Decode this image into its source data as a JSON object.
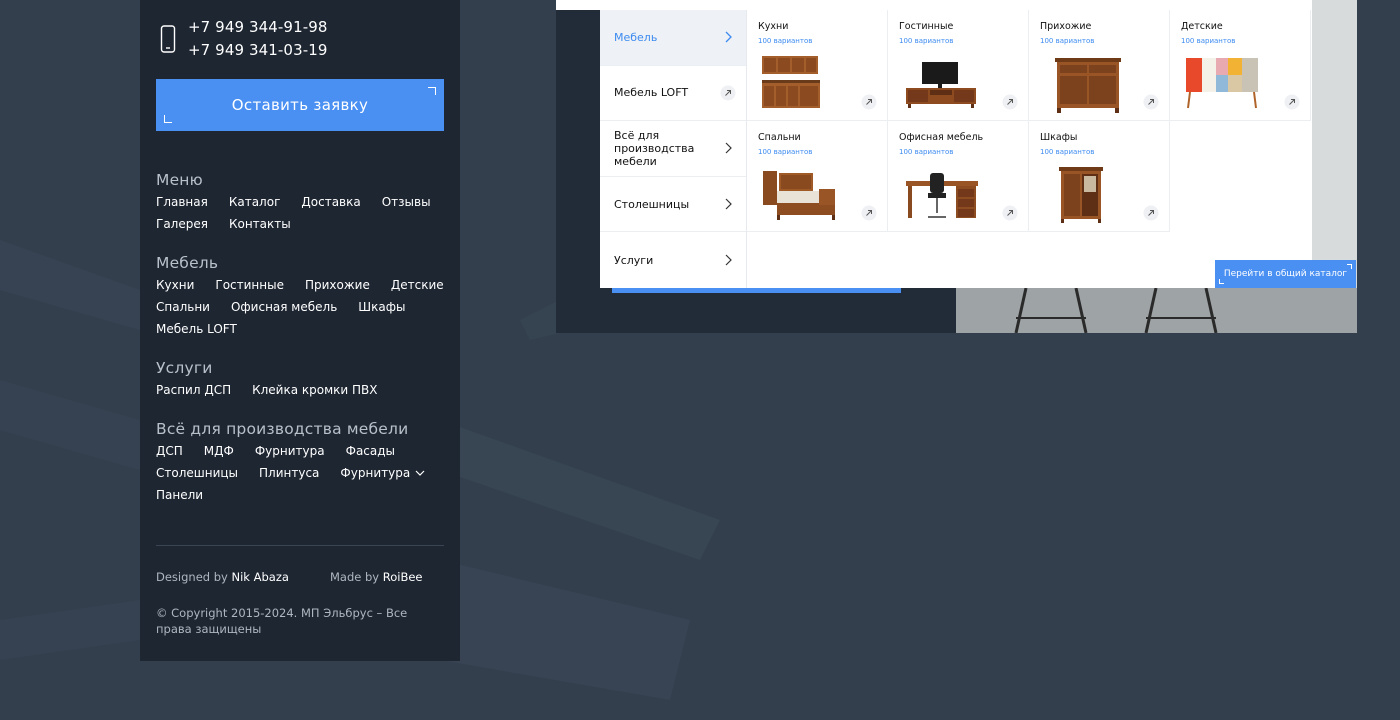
{
  "footer": {
    "phones": [
      "+7 949 344-91-98",
      "+7 949 341-03-19"
    ],
    "cta_label": "Оставить заявку",
    "sections": [
      {
        "heading": "Меню",
        "links": [
          "Главная",
          "Каталог",
          "Доставка",
          "Отзывы",
          "Галерея",
          "Контакты"
        ]
      },
      {
        "heading": "Мебель",
        "links": [
          "Кухни",
          "Гостинные",
          "Прихожие",
          "Детские",
          "Спальни",
          "Офисная мебель",
          "Шкафы",
          "Мебель LOFT"
        ]
      },
      {
        "heading": "Услуги",
        "links": [
          "Распил ДСП",
          "Клейка кромки ПВХ"
        ]
      },
      {
        "heading": "Всё для производства мебели",
        "links": [
          "ДСП",
          "МДФ",
          "Фурнитура",
          "Фасады",
          "Столешницы",
          "Плинтуса",
          "Фурнитура",
          "Панели"
        ]
      }
    ],
    "designed_prefix": "Designed by",
    "designed_name": "Nik Abaza",
    "made_prefix": "Made by",
    "made_name": "RoiBee",
    "copyright": "© Copyright 2015-2024. МП Эльбрус – Все права защищены"
  },
  "catalog": {
    "menu": [
      {
        "label": "Мебель",
        "active": true,
        "icon": "chevron-right-icon"
      },
      {
        "label": "Мебель LOFT",
        "active": false,
        "icon": "arrow-up-right-icon"
      },
      {
        "label": "Всё для производства мебели",
        "active": false,
        "icon": "chevron-right-icon"
      },
      {
        "label": "Столешницы",
        "active": false,
        "icon": "chevron-right-icon"
      },
      {
        "label": "Услуги",
        "active": false,
        "icon": "chevron-right-icon"
      }
    ],
    "items": [
      {
        "title": "Кухни",
        "subtitle": "100 вариантов",
        "image": "kitchen-image"
      },
      {
        "title": "Гостинные",
        "subtitle": "100 вариантов",
        "image": "tv-stand-image"
      },
      {
        "title": "Прихожие",
        "subtitle": "100 вариантов",
        "image": "cabinet-image"
      },
      {
        "title": "Детские",
        "subtitle": "100 вариантов",
        "image": "dresser-image"
      },
      {
        "title": "Спальни",
        "subtitle": "100 вариантов",
        "image": "bed-image"
      },
      {
        "title": "Офисная мебель",
        "subtitle": "100 вариантов",
        "image": "office-desk-image"
      },
      {
        "title": "Шкафы",
        "subtitle": "100 вариантов",
        "image": "wardrobe-image"
      }
    ],
    "all_catalog_label": "Перейти в общий каталог"
  },
  "colors": {
    "accent": "#4a90f2",
    "footer_bg": "#1e2632",
    "page_bg": "#333f4d"
  }
}
